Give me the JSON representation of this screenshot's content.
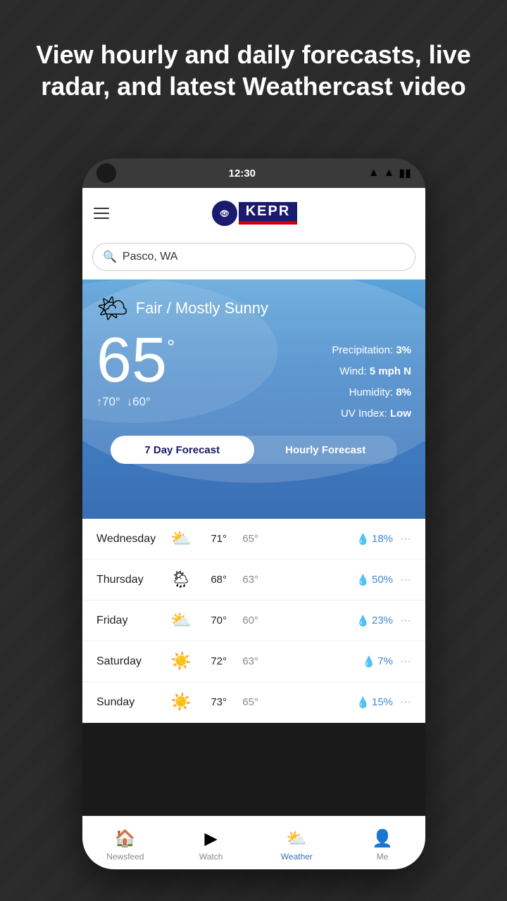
{
  "tagline": "View hourly and daily forecasts, live radar, and latest Weathercast video",
  "status": {
    "time": "12:30"
  },
  "header": {
    "logo_cbs": "CBS",
    "logo_name": "KEPR",
    "menu_label": "menu"
  },
  "search": {
    "placeholder": "Pasco, WA",
    "value": "Pasco, WA"
  },
  "weather": {
    "condition": "Fair / Mostly Sunny",
    "temperature": "65",
    "degree_symbol": "°",
    "high": "70°",
    "low": "60°",
    "precipitation_label": "Precipitation:",
    "precipitation_value": "3%",
    "wind_label": "Wind:",
    "wind_value": "5 mph N",
    "humidity_label": "Humidity:",
    "humidity_value": "8%",
    "uv_label": "UV Index:",
    "uv_value": "Low"
  },
  "forecast_tabs": {
    "seven_day": "7 Day Forecast",
    "hourly": "Hourly Forecast"
  },
  "forecast": [
    {
      "day": "Wednesday",
      "icon": "⛅",
      "high": "71°",
      "low": "65°",
      "precip": "18%"
    },
    {
      "day": "Thursday",
      "icon": "🌦",
      "high": "68°",
      "low": "63°",
      "precip": "50%"
    },
    {
      "day": "Friday",
      "icon": "⛅",
      "high": "70°",
      "low": "60°",
      "precip": "23%"
    },
    {
      "day": "Saturday",
      "icon": "☀️",
      "high": "72°",
      "low": "63°",
      "precip": "7%"
    },
    {
      "day": "Sunday",
      "icon": "☀️",
      "high": "73°",
      "low": "65°",
      "precip": "15%"
    }
  ],
  "bottom_nav": [
    {
      "id": "newsfeed",
      "label": "Newsfeed",
      "icon": "🏠",
      "active": false
    },
    {
      "id": "watch",
      "label": "Watch",
      "icon": "▶",
      "active": false
    },
    {
      "id": "weather",
      "label": "Weather",
      "icon": "⛅",
      "active": true
    },
    {
      "id": "me",
      "label": "Me",
      "icon": "👤",
      "active": false
    }
  ]
}
